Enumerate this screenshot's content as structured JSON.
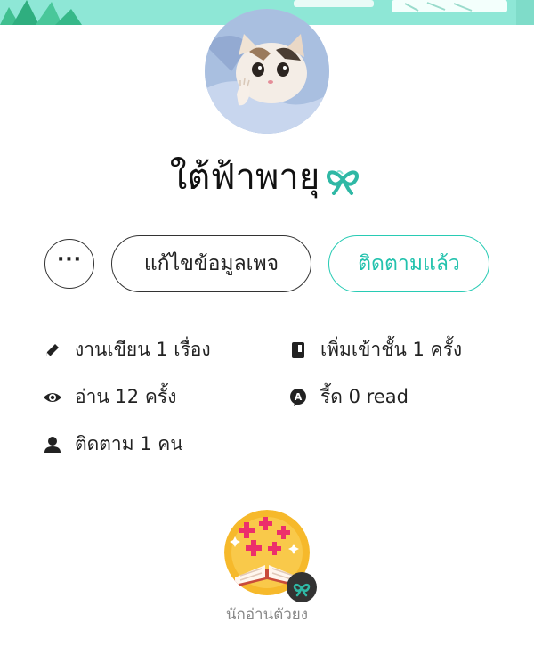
{
  "profile": {
    "display_name": "ใต้ฟ้าพายุ"
  },
  "actions": {
    "more_label": "···",
    "edit_label": "แก้ไขข้อมูลเพจ",
    "follow_label": "ติดตามแล้ว"
  },
  "stats": {
    "works": "งานเขียน 1 เรื่อง",
    "shelf_adds": "เพิ่มเข้าชั้น 1 ครั้ง",
    "reads": "อ่าน 12 ครั้ง",
    "read_reaction": "รี้ด 0 read",
    "followers": "ติดตาม 1 คน"
  },
  "badge": {
    "label": "นักอ่านตัวยง"
  },
  "colors": {
    "accent": "#22c2ad",
    "banner": "#8ee7d6"
  },
  "icons": {
    "works": "pencil-icon",
    "shelf": "book-icon",
    "reads": "eye-icon",
    "read_reaction": "speech-bubble-a-icon",
    "followers": "person-icon",
    "name_badge": "ribbon-icon"
  }
}
